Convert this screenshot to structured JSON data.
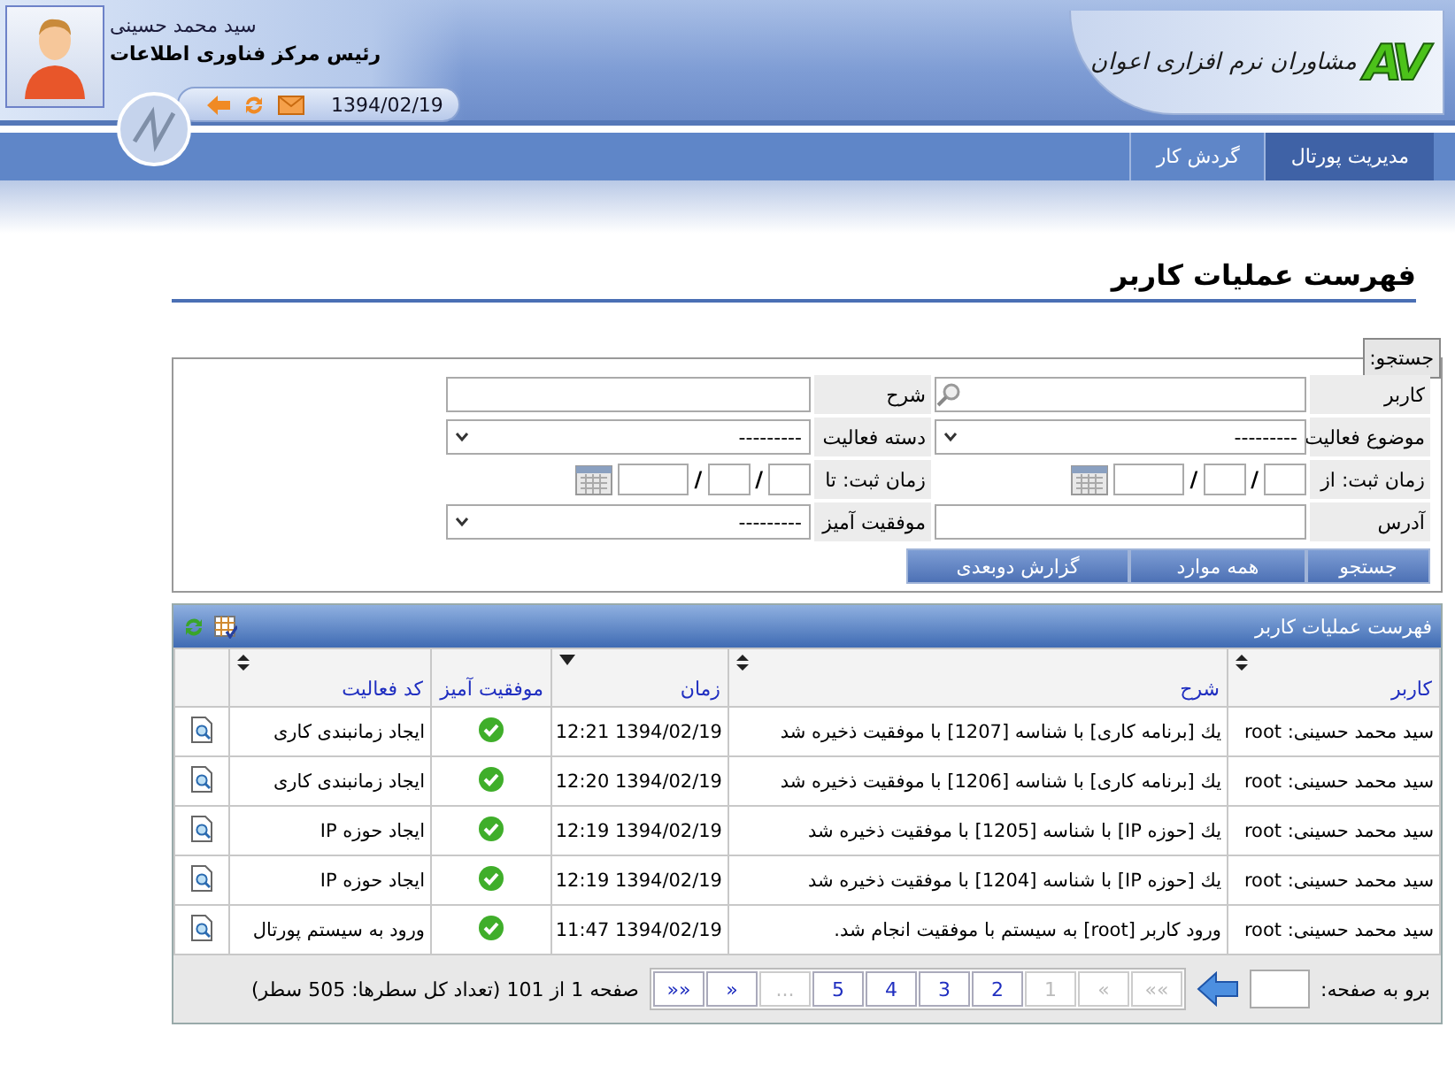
{
  "header": {
    "logo_mark": "AV",
    "company": "مشاوران نرم افزاری اعوان",
    "user": {
      "name": "سید محمد حسینی",
      "role": "رئیس مرکز فناوری اطلاعات"
    },
    "date": "1394/02/19"
  },
  "nav": {
    "tabs": [
      {
        "label": "مدیریت پورتال",
        "selected": true
      },
      {
        "label": "گردش کار",
        "selected": false
      }
    ]
  },
  "page_title": "فهرست عملیات کاربر",
  "search": {
    "legend": "جستجو:",
    "fields": [
      {
        "label": "کاربر",
        "kind": "lookup"
      },
      {
        "label": "شرح",
        "kind": "text"
      },
      {
        "label": "موضوع فعالیت",
        "kind": "select",
        "value": "---------"
      },
      {
        "label": "دسته فعالیت",
        "kind": "select",
        "value": "---------"
      },
      {
        "label": "زمان ثبت: از",
        "kind": "date",
        "separator": "/"
      },
      {
        "label": "زمان ثبت: تا",
        "kind": "date",
        "separator": "/"
      },
      {
        "label": "آدرس",
        "kind": "text"
      },
      {
        "label": "موفقیت آمیز",
        "kind": "select",
        "value": "---------"
      }
    ],
    "buttons": [
      "جستجو",
      "همه موارد",
      "گزارش دوبعدی"
    ]
  },
  "grid": {
    "title": "فهرست عملیات کاربر",
    "columns": [
      {
        "label": "کاربر",
        "kind": "sortable"
      },
      {
        "label": "شرح",
        "kind": "sortable"
      },
      {
        "label": "زمان",
        "kind": "sorted"
      },
      {
        "label": "موفقیت آمیز",
        "kind": "plain"
      },
      {
        "label": "کد فعالیت",
        "kind": "sortable"
      }
    ],
    "rows": [
      {
        "user": "سید محمد حسینی: root",
        "description": "یك [برنامه کاری] با شناسه [1207] با موفقیت ذخیره شد",
        "time": "1394/02/19 12:21",
        "success": true,
        "activity": "ایجاد زمانبندی کاری"
      },
      {
        "user": "سید محمد حسینی: root",
        "description": "یك [برنامه کاری] با شناسه [1206] با موفقیت ذخیره شد",
        "time": "1394/02/19 12:20",
        "success": true,
        "activity": "ایجاد زمانبندی کاری"
      },
      {
        "user": "سید محمد حسینی: root",
        "description": "یك [حوزه IP] با شناسه [1205] با موفقیت ذخیره شد",
        "time": "1394/02/19 12:19",
        "success": true,
        "activity": "ایجاد حوزه IP"
      },
      {
        "user": "سید محمد حسینی: root",
        "description": "یك [حوزه IP] با شناسه [1204] با موفقیت ذخیره شد",
        "time": "1394/02/19 12:19",
        "success": true,
        "activity": "ایجاد حوزه IP"
      },
      {
        "user": "سید محمد حسینی: root",
        "description": "ورود کاربر [root] به سیستم با موفقیت انجام شد.",
        "time": "1394/02/19 11:47",
        "success": true,
        "activity": "ورود به سیستم پورتال"
      }
    ],
    "pager": {
      "goto_label": "برو به صفحه:",
      "pages": [
        {
          "label": "««",
          "disabled": true
        },
        {
          "label": "«",
          "disabled": true
        },
        {
          "label": "1",
          "disabled": true
        },
        {
          "label": "2",
          "disabled": false
        },
        {
          "label": "3",
          "disabled": false
        },
        {
          "label": "4",
          "disabled": false
        },
        {
          "label": "5",
          "disabled": false
        },
        {
          "label": "...",
          "disabled": true
        },
        {
          "label": "»",
          "disabled": false
        },
        {
          "label": "»»",
          "disabled": false
        }
      ],
      "summary": "صفحه 1 از 101 (تعداد کل سطرها: 505 سطر)"
    }
  }
}
